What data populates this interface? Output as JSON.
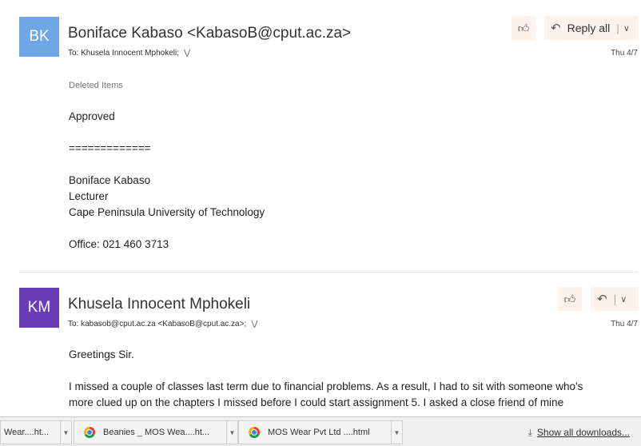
{
  "messages": [
    {
      "initials": "BK",
      "avatar_color": "#6ea6e6",
      "sender": "Boniface Kabaso <KabasoB@cput.ac.za>",
      "to_label": "To:",
      "to": "Khusela Innocent Mphokeli;",
      "date": "Thu 4/7",
      "reply_label": "Reply all",
      "folder": "Deleted Items",
      "body": [
        "Approved",
        "=============",
        "Boniface Kabaso",
        "Lecturer",
        "Cape Peninsula University of Technology",
        "Office: 021 460 3713"
      ]
    },
    {
      "initials": "KM",
      "avatar_color": "#6a3cb5",
      "sender": "Khusela Innocent Mphokeli",
      "to_label": "To:",
      "to": "kabasob@cput.ac.za <KabasoB@cput.ac.za>;",
      "date": "Thu 4/7",
      "body": [
        "Greetings Sir.",
        "I missed a couple of classes last term due to financial problems. As a result, I had to sit with someone who's",
        "more clued up on the chapters I missed before I could start assignment 5. I asked a close friend of mine"
      ]
    }
  ],
  "downloads": {
    "items": [
      "Wear....ht...",
      "Beanies _ MOS Wea....ht...",
      "MOS Wear Pvt Ltd ....html"
    ],
    "show_all": "Show all downloads..."
  }
}
